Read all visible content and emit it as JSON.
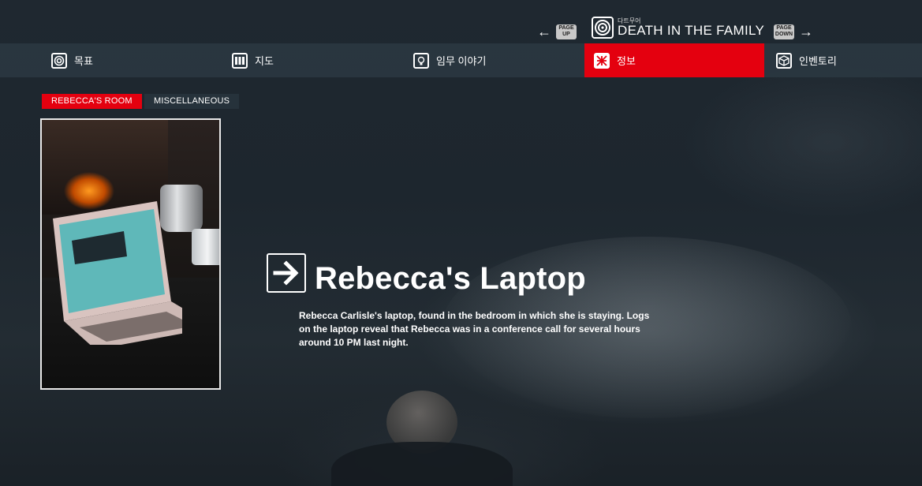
{
  "header": {
    "page_up_label": "PAGE\nUP",
    "page_down_label": "PAGE\nDOWN",
    "mission_subtitle": "다트무어",
    "mission_title": "DEATH IN THE FAMILY"
  },
  "tabs": [
    {
      "label": "목표",
      "icon": "target-icon",
      "active": false
    },
    {
      "label": "지도",
      "icon": "map-icon",
      "active": false
    },
    {
      "label": "임무 이야기",
      "icon": "lightbulb-icon",
      "active": false
    },
    {
      "label": "정보",
      "icon": "intel-icon",
      "active": true
    },
    {
      "label": "인벤토리",
      "icon": "inventory-box-icon",
      "active": false
    }
  ],
  "subtabs": [
    {
      "label": "REBECCA'S ROOM",
      "active": true
    },
    {
      "label": "MISCELLANEOUS",
      "active": false
    }
  ],
  "item": {
    "title": "Rebecca's Laptop",
    "description": "Rebecca Carlisle's laptop, found in the bedroom in which she is staying. Logs on the laptop reveal that Rebecca was in a conference call for several hours around 10 PM last night.",
    "image_subject": "laptop-on-table-by-fireplace"
  },
  "colors": {
    "accent": "#e4000f",
    "tab_bar": "#2c3842",
    "background": "#1b232b"
  }
}
